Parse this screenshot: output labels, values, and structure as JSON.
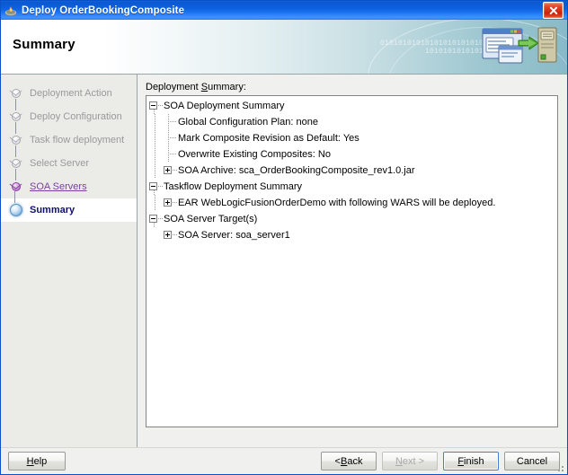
{
  "window": {
    "title": "Deploy OrderBookingComposite",
    "app_icon": "deploy-app-icon",
    "close_icon": "close-icon"
  },
  "banner": {
    "title": "Summary",
    "binary_line_1": "010101010101010101010101",
    "binary_line_2": "10101010101010",
    "art_icon": "deploy-to-server-icon"
  },
  "sidebar": {
    "items": [
      {
        "label": "Deployment Action",
        "state": "done"
      },
      {
        "label": "Deploy Configuration",
        "state": "done"
      },
      {
        "label": "Task flow deployment",
        "state": "done"
      },
      {
        "label": "Select Server",
        "state": "done"
      },
      {
        "label": "SOA Servers",
        "state": "link"
      },
      {
        "label": "Summary",
        "state": "current"
      }
    ]
  },
  "content": {
    "label_prefix": "Deployment ",
    "label_mnemonic": "S",
    "label_suffix": "ummary:",
    "tree": [
      {
        "depth": 0,
        "toggle": "minus",
        "text": "SOA Deployment Summary"
      },
      {
        "depth": 1,
        "toggle": "none",
        "text": "Global Configuration Plan: none"
      },
      {
        "depth": 1,
        "toggle": "none",
        "text": "Mark Composite Revision as Default: Yes"
      },
      {
        "depth": 1,
        "toggle": "none",
        "text": "Overwrite Existing Composites: No"
      },
      {
        "depth": 1,
        "toggle": "plus",
        "text": "SOA Archive: sca_OrderBookingComposite_rev1.0.jar"
      },
      {
        "depth": 0,
        "toggle": "minus",
        "text": "Taskflow Deployment Summary"
      },
      {
        "depth": 1,
        "toggle": "plus",
        "text": "EAR WebLogicFusionOrderDemo with following WARS will be deployed."
      },
      {
        "depth": 0,
        "toggle": "minus",
        "text": "SOA Server Target(s)"
      },
      {
        "depth": 1,
        "toggle": "plus",
        "text": "SOA Server: soa_server1"
      }
    ]
  },
  "footer": {
    "help": {
      "pre": "",
      "key": "H",
      "post": "elp",
      "disabled": false,
      "default": false
    },
    "back": {
      "pre": "< ",
      "key": "B",
      "post": "ack",
      "disabled": false,
      "default": false
    },
    "next": {
      "pre": "",
      "key": "N",
      "post": "ext >",
      "disabled": true,
      "default": false
    },
    "finish": {
      "pre": "",
      "key": "F",
      "post": "inish",
      "disabled": false,
      "default": true
    },
    "cancel": {
      "pre": "",
      "key": "",
      "post": "Cancel",
      "disabled": false,
      "default": false
    }
  },
  "colors": {
    "titlebar": "#0d62e0",
    "link": "#7a3fa0",
    "active_step": "#101070",
    "close_red": "#cc2108"
  }
}
